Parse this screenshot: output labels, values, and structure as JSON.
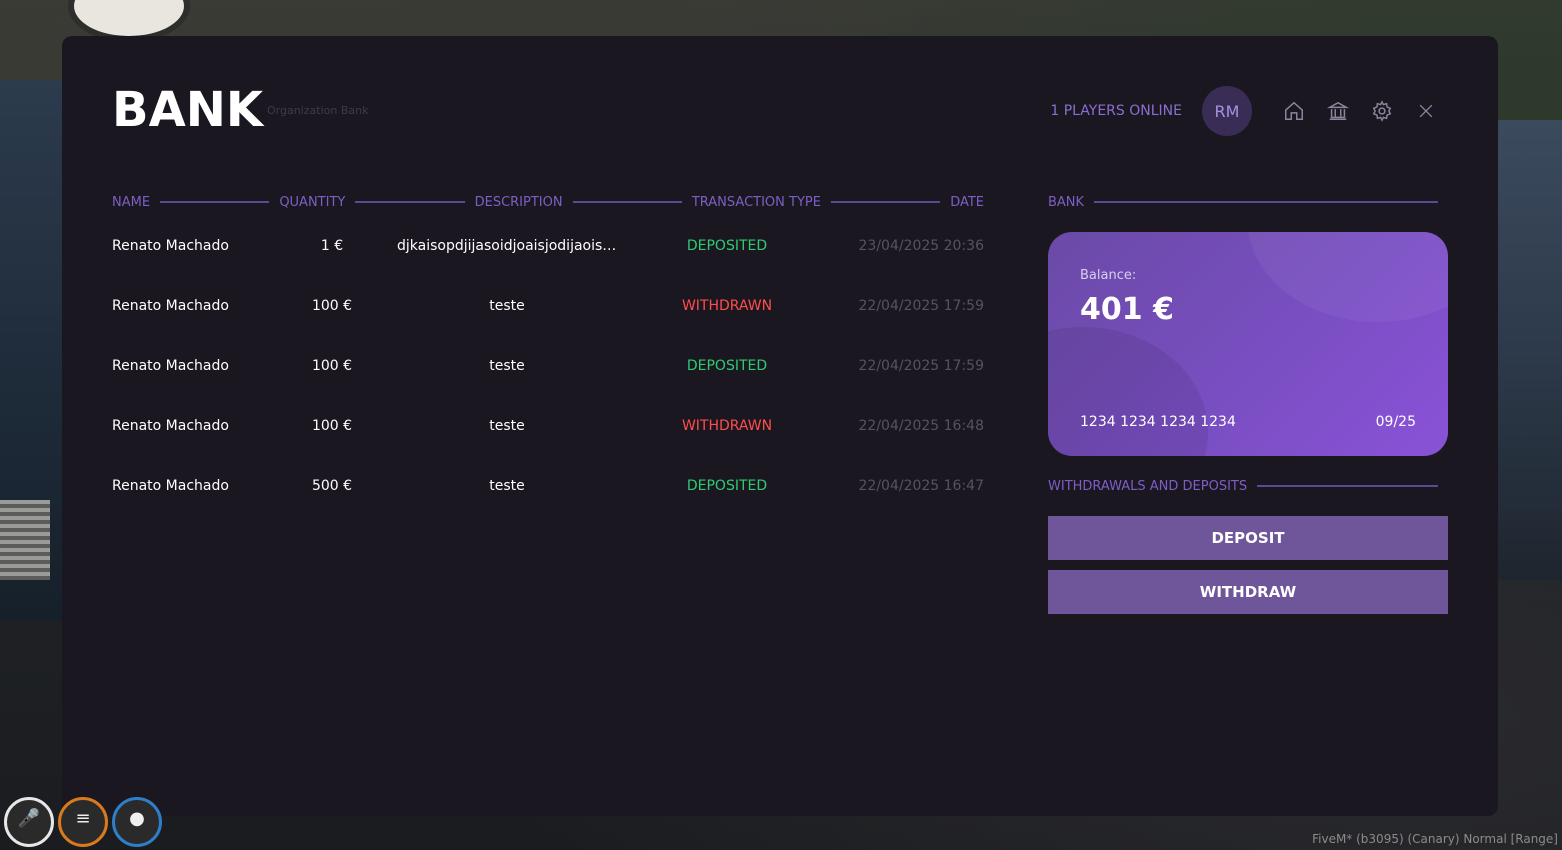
{
  "header": {
    "title": "BANK",
    "subtitle": "Organization Bank",
    "players_online": "1 PLAYERS ONLINE",
    "avatar_initials": "RM"
  },
  "table": {
    "columns": [
      "NAME",
      "QUANTITY",
      "DESCRIPTION",
      "TRANSACTION TYPE",
      "DATE"
    ],
    "rows": [
      {
        "name": "Renato Machado",
        "quantity": "1 €",
        "description": "djkaisopdjijasoidjoaisjodijaoisjdio...",
        "type": "DEPOSITED",
        "date": "23/04/2025 20:36"
      },
      {
        "name": "Renato Machado",
        "quantity": "100 €",
        "description": "teste",
        "type": "WITHDRAWN",
        "date": "22/04/2025 17:59"
      },
      {
        "name": "Renato Machado",
        "quantity": "100 €",
        "description": "teste",
        "type": "DEPOSITED",
        "date": "22/04/2025 17:59"
      },
      {
        "name": "Renato Machado",
        "quantity": "100 €",
        "description": "teste",
        "type": "WITHDRAWN",
        "date": "22/04/2025 16:48"
      },
      {
        "name": "Renato Machado",
        "quantity": "500 €",
        "description": "teste",
        "type": "DEPOSITED",
        "date": "22/04/2025 16:47"
      }
    ]
  },
  "bank": {
    "heading": "BANK",
    "balance_label": "Balance:",
    "balance_value": "401 €",
    "card_number": "1234 1234 1234 1234",
    "card_expiry": "09/25"
  },
  "actions": {
    "heading": "WITHDRAWALS AND DEPOSITS",
    "deposit_label": "DEPOSIT",
    "withdraw_label": "WITHDRAW"
  },
  "footer": {
    "watermark": "FiveM* (b3095) (Canary)  Normal [Range]"
  },
  "colors": {
    "accent": "#7c5fc6",
    "deposited": "#2ecc71",
    "withdrawn": "#ff4d4d",
    "modal_bg": "#1b1720"
  },
  "icons": [
    "home-icon",
    "bank-icon",
    "gear-icon",
    "close-icon",
    "microphone-icon",
    "food-icon",
    "water-icon"
  ]
}
